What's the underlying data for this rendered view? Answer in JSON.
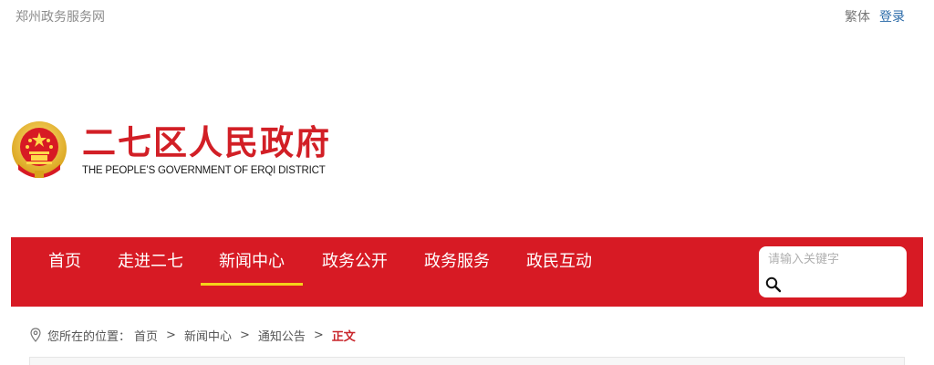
{
  "topbar": {
    "portal_label": "郑州政务服务网",
    "traditional_label": "繁体",
    "login_label": "登录"
  },
  "brand": {
    "title": "二七区人民政府",
    "subtitle": "THE PEOPLE’S GOVERNMENT OF ERQI DISTRICT",
    "emblem_icon": "national-emblem-icon"
  },
  "nav": {
    "items": [
      {
        "label": "首页"
      },
      {
        "label": "走进二七"
      },
      {
        "label": "新闻中心",
        "active": true
      },
      {
        "label": "政务公开"
      },
      {
        "label": "政务服务"
      },
      {
        "label": "政民互动"
      }
    ],
    "search_placeholder": "请输入关键字",
    "search_value": ""
  },
  "breadcrumb": {
    "prefix": "您所在的位置：",
    "items": [
      "首页",
      "新闻中心",
      "通知公告"
    ],
    "separator": ">",
    "current": "正文"
  },
  "colors": {
    "brand_red": "#d71a24",
    "title_red": "#d21f26",
    "active_underline": "#f5d21a",
    "link_blue": "#2a6aa8"
  }
}
